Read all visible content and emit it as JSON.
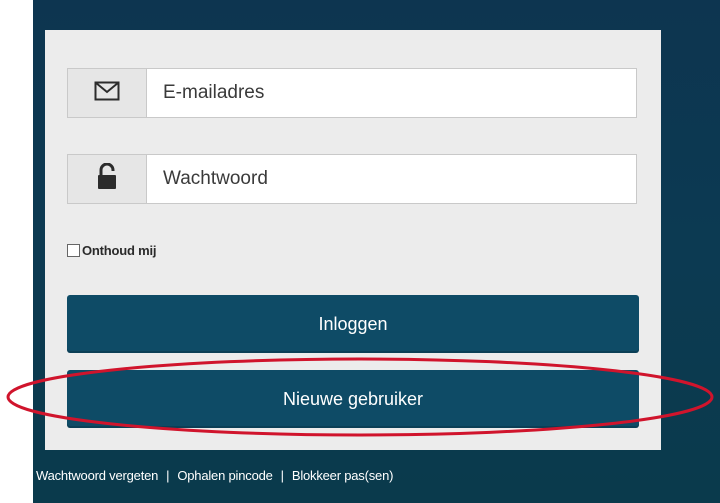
{
  "login": {
    "email_placeholder": "E-mailadres",
    "password_placeholder": "Wachtwoord",
    "remember_label": "Onthoud mij",
    "login_button": "Inloggen",
    "new_user_button": "Nieuwe gebruiker"
  },
  "footer": {
    "links": [
      "Wachtwoord vergeten",
      "Ophalen pincode",
      "Blokkeer pas(sen)"
    ],
    "separator": "|"
  },
  "colors": {
    "accent": "#0e4b66",
    "background": "#0c3a52",
    "highlight": "#d0142c"
  },
  "icons": {
    "email": "envelope-icon",
    "password": "unlock-icon"
  }
}
